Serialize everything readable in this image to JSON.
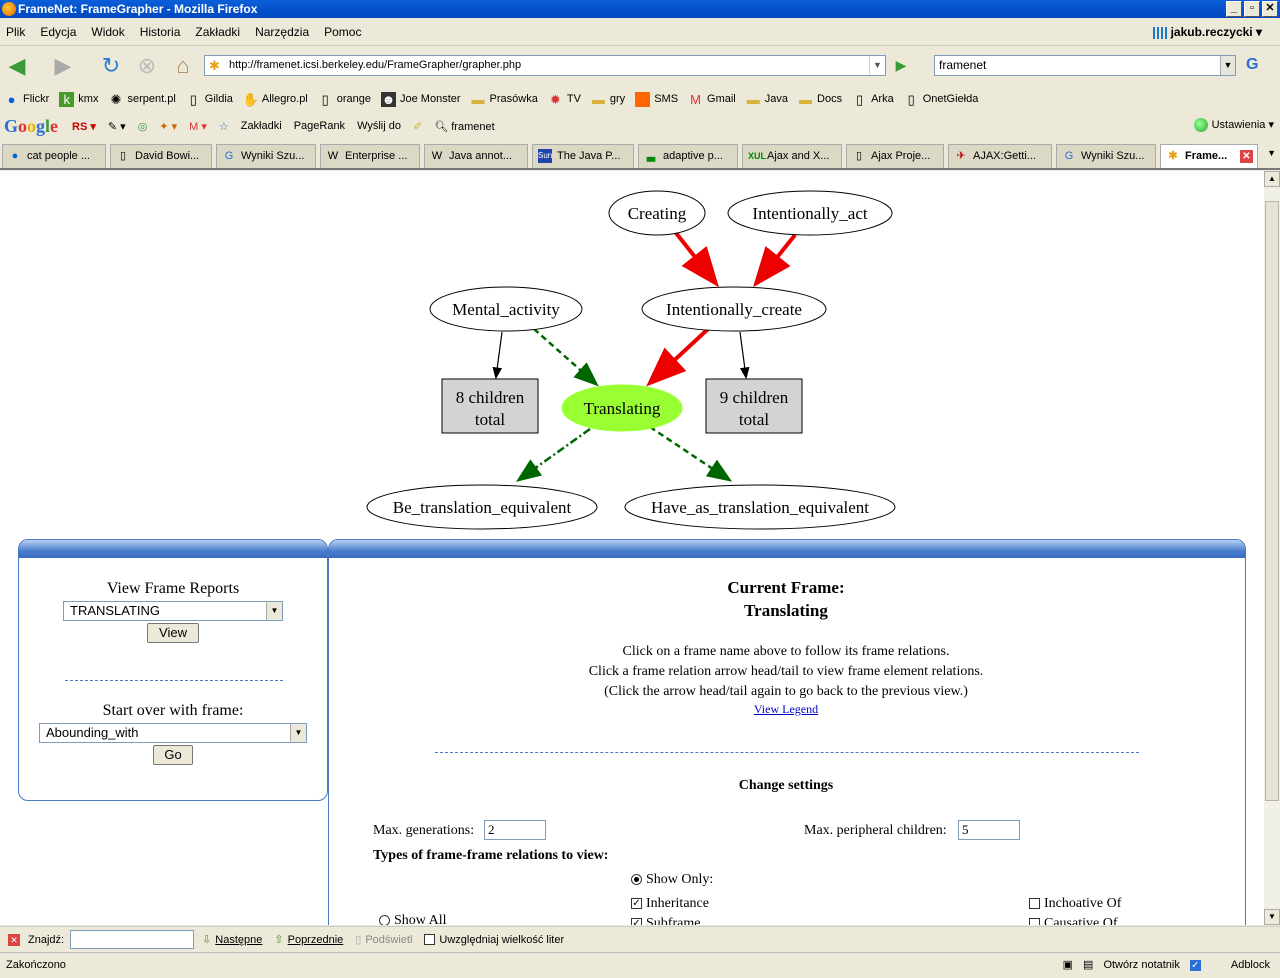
{
  "window": {
    "title": "FrameNet: FrameGrapher - Mozilla Firefox"
  },
  "menu": [
    "Plik",
    "Edycja",
    "Widok",
    "Historia",
    "Zakładki",
    "Narzędzia",
    "Pomoc"
  ],
  "user": "jakub.reczycki",
  "url": "http://framenet.icsi.berkeley.edu/FrameGrapher/grapher.php",
  "search": {
    "value": "framenet",
    "engine_icon": "google-icon"
  },
  "bookmarks": [
    "Flickr",
    "kmx",
    "serpent.pl",
    "Gildia",
    "Allegro.pl",
    "orange",
    "Joe Monster",
    "Prasówka",
    "TV",
    "gry",
    "SMS",
    "Gmail",
    "Java",
    "Docs",
    "Arka",
    "OnetGiełda"
  ],
  "google_toolbar": {
    "logo": "Google",
    "items": [
      "Zakładki",
      "PageRank",
      "Wyślij do",
      "framenet"
    ],
    "settings": "Ustawienia"
  },
  "tabs": [
    "cat people ...",
    "David Bowi...",
    "Wyniki Szu...",
    "Enterprise ...",
    "Java annot...",
    "The Java P...",
    "adaptive p...",
    "Ajax and X...",
    "Ajax Proje...",
    "AJAX:Getti...",
    "Wyniki Szu...",
    "Frame..."
  ],
  "graph": {
    "nodes": {
      "creating": "Creating",
      "intentionally_act": "Intentionally_act",
      "mental_activity": "Mental_activity",
      "intentionally_create": "Intentionally_create",
      "translating": "Translating",
      "children_left_1": "8 children",
      "children_left_2": "total",
      "children_right_1": "9 children",
      "children_right_2": "total",
      "be_translation": "Be_translation_equivalent",
      "have_translation": "Have_as_translation_equivalent"
    },
    "colors": {
      "inheritance": "#ee0000",
      "using": "#006600",
      "current": "#99ff33"
    }
  },
  "left_panel": {
    "view_reports_label": "View Frame Reports",
    "report_select": "TRANSLATING",
    "view_button": "View",
    "start_over_label": "Start over with frame:",
    "start_select": "Abounding_with",
    "go_button": "Go"
  },
  "right_panel": {
    "current_frame_label": "Current Frame:",
    "current_frame": "Translating",
    "instr1": "Click on a frame name above to follow its frame relations.",
    "instr2": "Click a frame relation arrow head/tail to view frame element relations.",
    "instr3": "(Click the arrow head/tail again to go back to the previous view.)",
    "legend_link": "View Legend",
    "change_settings": "Change settings",
    "max_generations_label": "Max. generations:",
    "max_generations": "2",
    "max_peripheral_label": "Max. peripheral children:",
    "max_peripheral": "5",
    "types_label": "Types of frame-frame relations to view:",
    "show_only": "Show Only:",
    "show_all": "Show All",
    "inheritance": "Inheritance",
    "subframe": "Subframe",
    "inchoative": "Inchoative Of",
    "causative": "Causative Of"
  },
  "findbar": {
    "label": "Znajdź:",
    "next": "Następne",
    "prev": "Poprzednie",
    "highlight": "Podświetl",
    "match_case": "Uwzględniaj wielkość liter"
  },
  "status": {
    "text": "Zakończono",
    "notepad": "Otwórz notatnik",
    "adblock": "Adblock"
  }
}
